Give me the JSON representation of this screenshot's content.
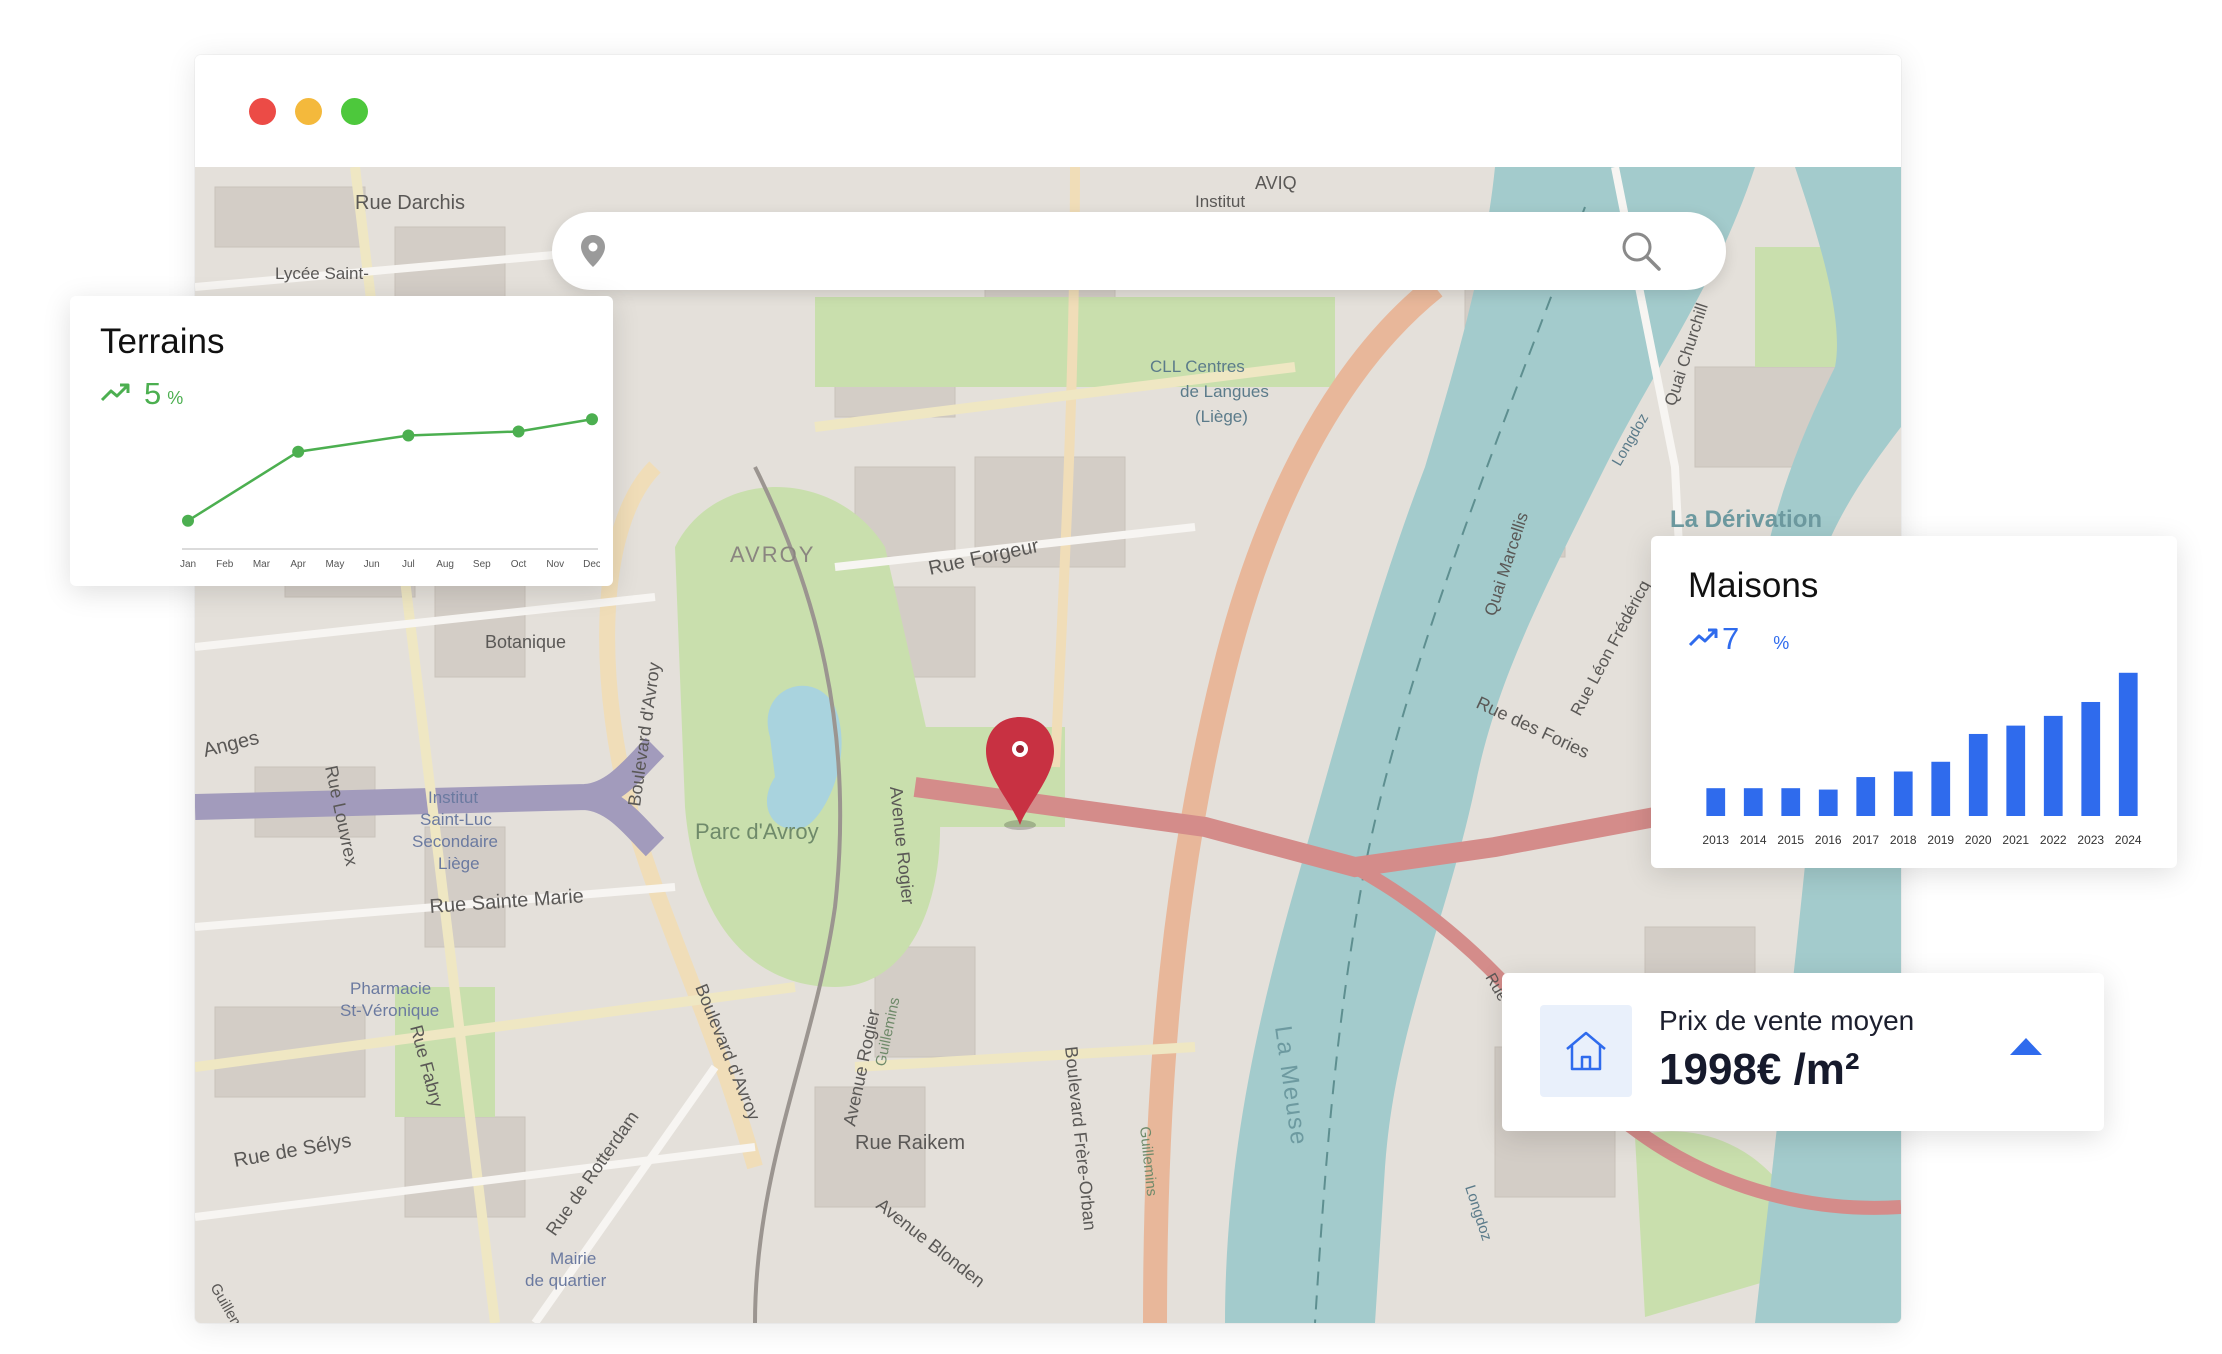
{
  "search": {
    "placeholder": ""
  },
  "map": {
    "streets": {
      "rue_darchis": "Rue Darchis",
      "lycee": "Lycée Saint-",
      "avenue_rogier_1": "Avenue Rogier",
      "avenue_rogier_2": "Avenue Rogier",
      "boulevard_avroy_1": "Boulevard d'Avroy",
      "boulevard_avroy_2": "Boulevard d'Avroy",
      "rue_forgeur": "Rue Forgeur",
      "avroy": "AVROY",
      "parc": "Parc d'Avroy",
      "botanique": "Botanique",
      "institut_1": "Institut",
      "institut_2": "Saint-Luc",
      "institut_3": "Secondaire",
      "institut_4": "Liège",
      "rue_sainte_marie": "Rue Sainte Marie",
      "rue_louvrex": "Rue Louvrex",
      "anges": "Anges",
      "pharmacie_1": "Pharmacie",
      "pharmacie_2": "St-Véronique",
      "rue_fabry": "Rue Fabry",
      "rue_selys": "Rue de Sélys",
      "rue_rotterdam": "Rue de Rotterdam",
      "rue_raikem": "Rue Raikem",
      "avenue_blonden": "Avenue Blonden",
      "boulevard_frere": "Boulevard Frère-Orban",
      "guillemins_1": "Guillemins",
      "guillemins_2": "Guillemins",
      "guillemins_3": "Guillemins",
      "mairie_1": "Mairie",
      "mairie_2": "de quartier",
      "la_meuse": "La Meuse",
      "la_derivation": "La Dérivation",
      "quai_marcellis": "Quai Marcellis",
      "rue_des_fories": "Rue des Fories",
      "rue_leon": "Rue Léon Frédéricq",
      "quai_churchill": "Quai Churchill",
      "longdoz_1": "Longdoz",
      "longdoz_2": "Longdoz",
      "rue_du_parc": "Rue du Parc",
      "cll_1": "CLL Centres",
      "cll_2": "de Langues",
      "cll_3": "(Liège)",
      "aviq": "AVIQ",
      "institut_top": "Institut"
    }
  },
  "terrains": {
    "title": "Terrains",
    "change": "5",
    "unit": "%",
    "color": "#4caf50",
    "chart_data": {
      "type": "line",
      "categories": [
        "Jan",
        "Feb",
        "Mar",
        "Apr",
        "May",
        "Jun",
        "Jul",
        "Aug",
        "Sep",
        "Oct",
        "Nov",
        "Dec"
      ],
      "points": [
        {
          "x": "Jan",
          "y": 10
        },
        {
          "x": "Apr",
          "y": 44
        },
        {
          "x": "Jul",
          "y": 52
        },
        {
          "x": "Oct",
          "y": 54
        },
        {
          "x": "Dec",
          "y": 60
        }
      ],
      "ylim": [
        0,
        70
      ],
      "title": "Terrains"
    }
  },
  "maisons": {
    "title": "Maisons",
    "change": "7",
    "unit": "%",
    "color": "#2f6bed",
    "chart_data": {
      "type": "bar",
      "categories": [
        "2013",
        "2014",
        "2015",
        "2016",
        "2017",
        "2018",
        "2019",
        "2020",
        "2021",
        "2022",
        "2023",
        "2024"
      ],
      "values": [
        20,
        20,
        20,
        19,
        28,
        32,
        39,
        59,
        65,
        72,
        82,
        103
      ],
      "ylim": [
        0,
        105
      ],
      "title": "Maisons"
    }
  },
  "prix": {
    "label": "Prix de vente moyen",
    "value": "1998€ /m²",
    "accent": "#2f6bed"
  }
}
